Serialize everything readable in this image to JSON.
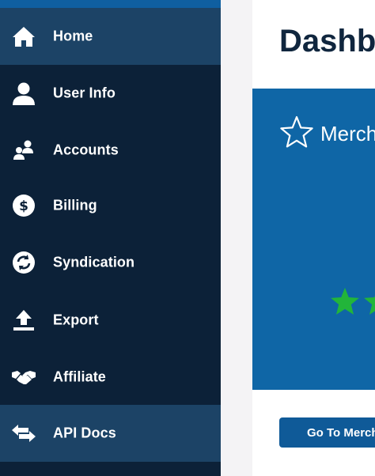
{
  "sidebar": {
    "items": [
      {
        "label": "Home",
        "icon": "home-icon",
        "active": true
      },
      {
        "label": "User Info",
        "icon": "user-icon",
        "active": false
      },
      {
        "label": "Accounts",
        "icon": "accounts-icon",
        "active": false
      },
      {
        "label": "Billing",
        "icon": "dollar-icon",
        "active": false
      },
      {
        "label": "Syndication",
        "icon": "sync-icon",
        "active": false
      },
      {
        "label": "Export",
        "icon": "upload-icon",
        "active": false
      },
      {
        "label": "Affiliate",
        "icon": "handshake-icon",
        "active": false
      },
      {
        "label": "API Docs",
        "icon": "swap-arrows-icon",
        "active": true
      }
    ]
  },
  "main": {
    "title": "Dashb",
    "card": {
      "title": "Merch",
      "icon": "star-outline-icon",
      "rating_color": "#22b53a"
    },
    "button_label": "Go To Merch"
  },
  "colors": {
    "sidebar_bg": "#0c2138",
    "sidebar_active": "#1c4366",
    "card_bg": "#0f66a6",
    "title_text": "#10263e"
  }
}
